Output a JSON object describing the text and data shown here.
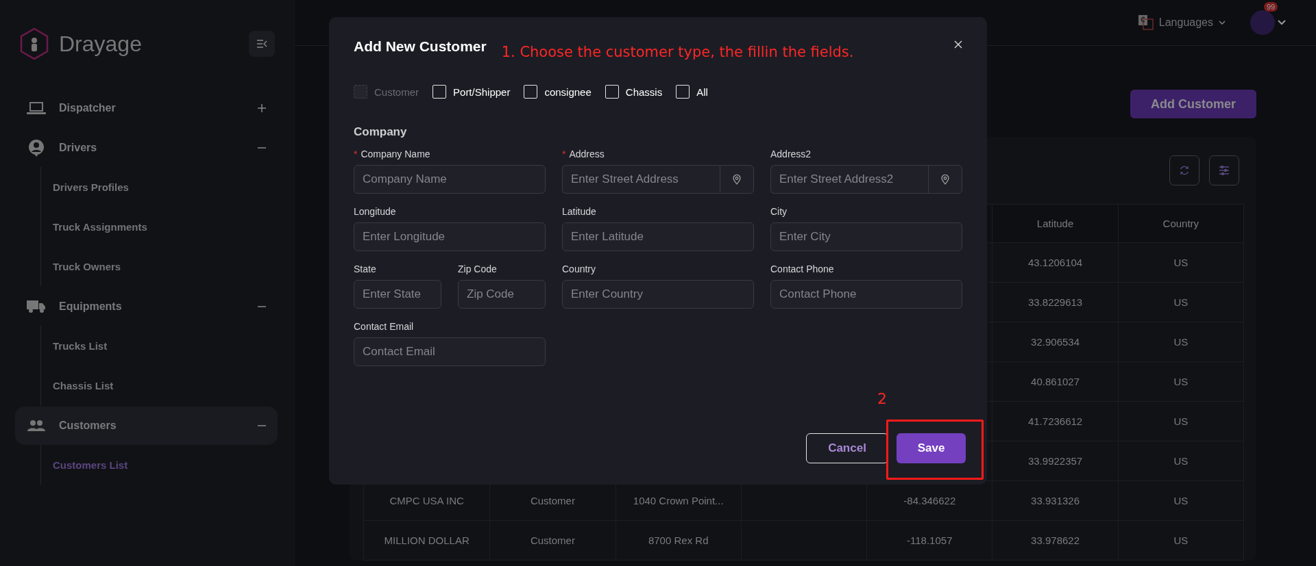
{
  "sidebar": {
    "logo": "Drayage",
    "items": [
      {
        "label": "Dispatcher",
        "expanded": false,
        "selected": false
      },
      {
        "label": "Drivers",
        "expanded": true,
        "selected": false,
        "children": [
          {
            "label": "Drivers Profiles",
            "selected": false
          },
          {
            "label": "Truck Assignments",
            "selected": false
          },
          {
            "label": "Truck Owners",
            "selected": false
          }
        ]
      },
      {
        "label": "Equipments",
        "expanded": true,
        "selected": false,
        "children": [
          {
            "label": "Trucks List",
            "selected": false
          },
          {
            "label": "Chassis List",
            "selected": false
          }
        ]
      },
      {
        "label": "Customers",
        "expanded": true,
        "selected": true,
        "children": [
          {
            "label": "Customers List",
            "selected": true
          }
        ]
      }
    ]
  },
  "topbar": {
    "languages": "Languages",
    "notification_count": "99"
  },
  "page": {
    "add_button": "Add Customer"
  },
  "table": {
    "columns": [
      null,
      null,
      null,
      null,
      null,
      "Latitude",
      "Country"
    ],
    "rows": [
      [
        null,
        null,
        null,
        null,
        null,
        "43.1206104",
        "US"
      ],
      [
        null,
        null,
        null,
        null,
        null,
        "33.8229613",
        "US"
      ],
      [
        null,
        null,
        null,
        null,
        null,
        "32.906534",
        "US"
      ],
      [
        null,
        null,
        null,
        null,
        null,
        "40.861027",
        "US"
      ],
      [
        null,
        null,
        null,
        null,
        null,
        "41.7236612",
        "US"
      ],
      [
        null,
        null,
        null,
        null,
        null,
        "33.9922357",
        "US"
      ],
      [
        "CMPC USA INC",
        "Customer",
        "1040 Crown Point...",
        null,
        "-84.346622",
        "33.931326",
        "US"
      ],
      [
        "MILLION DOLLAR",
        "Customer",
        "8700 Rex Rd",
        null,
        "-118.1057",
        "33.978622",
        "US"
      ]
    ]
  },
  "modal": {
    "title": "Add New Customer",
    "annotation": "1. Choose the customer type, the fillin the fields.",
    "types": [
      {
        "label": "Customer",
        "checked": false,
        "disabled": true
      },
      {
        "label": "Port/Shipper",
        "checked": false,
        "disabled": false
      },
      {
        "label": "consignee",
        "checked": false,
        "disabled": false
      },
      {
        "label": "Chassis",
        "checked": false,
        "disabled": false
      },
      {
        "label": "All",
        "checked": false,
        "disabled": false
      }
    ],
    "section": "Company",
    "fields": [
      {
        "label": "Company Name",
        "required_mark": "*",
        "placeholder": "Company Name",
        "kind": "text"
      },
      {
        "label": "Address",
        "required_mark": "*",
        "placeholder": "Enter Street Address",
        "kind": "location"
      },
      {
        "label": "Address2",
        "placeholder": "Enter Street Address2",
        "kind": "location"
      },
      {
        "label": "Longitude",
        "placeholder": "Enter Longitude",
        "kind": "text"
      },
      {
        "label": "Latitude",
        "placeholder": "Enter Latitude",
        "kind": "text"
      },
      {
        "label": "City",
        "placeholder": "Enter City",
        "kind": "text"
      },
      {
        "label": "State",
        "placeholder": "Enter State",
        "kind": "half"
      },
      {
        "label": "Zip Code",
        "placeholder": "Zip Code",
        "kind": "half"
      },
      {
        "label": "Country",
        "placeholder": "Enter Country",
        "kind": "text"
      },
      {
        "label": "Contact Phone",
        "placeholder": "Contact Phone",
        "kind": "text"
      },
      {
        "label": "Contact Email",
        "placeholder": "Contact Email",
        "kind": "text"
      }
    ],
    "cancel": "Cancel",
    "save": "Save",
    "step_marker": "2"
  }
}
